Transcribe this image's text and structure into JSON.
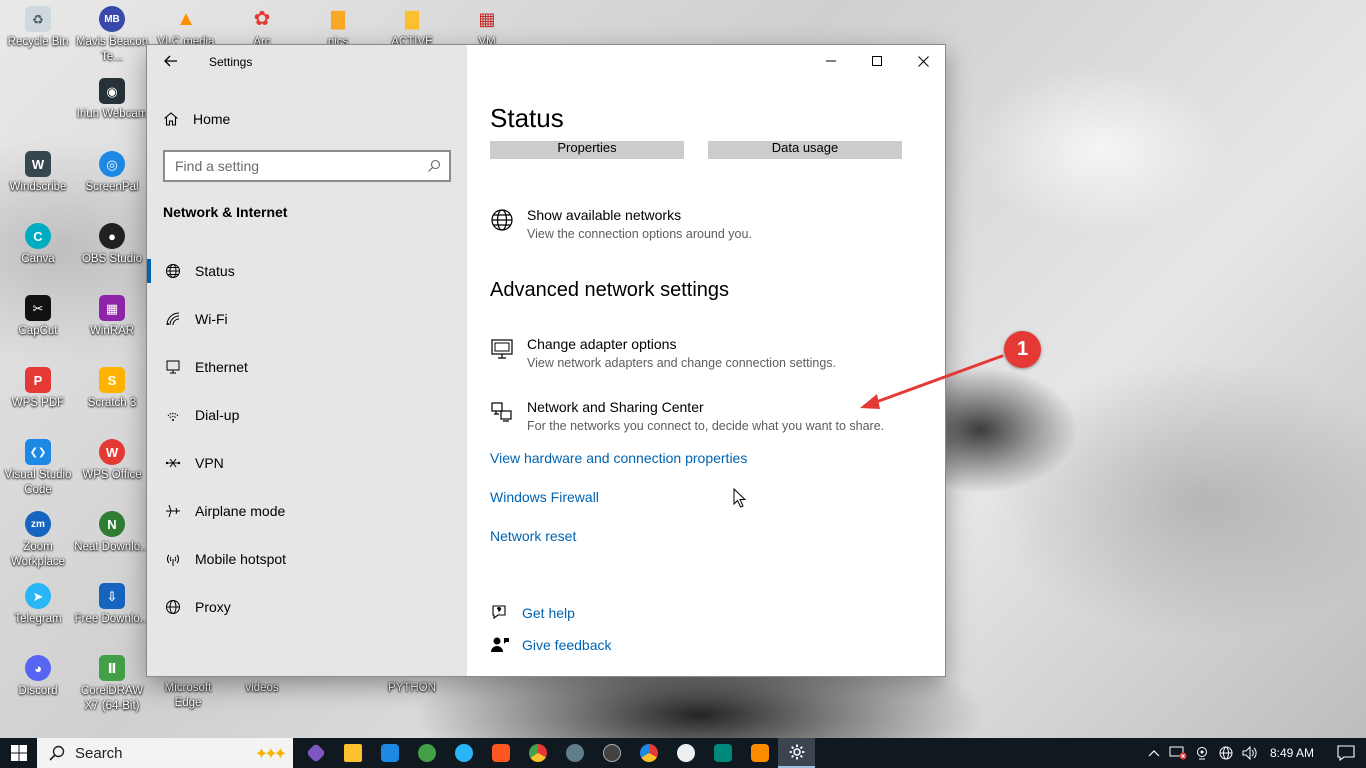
{
  "desktop": {
    "icons": [
      {
        "label": "Recycle Bin",
        "color": "#cfd8dc",
        "glyph": "♻"
      },
      {
        "label": "Mavis Beacon Te...",
        "color": "#3949ab",
        "glyph": "MB"
      },
      {
        "label": "VLC media",
        "color": "#ff8f00",
        "glyph": "▲"
      },
      {
        "label": "Arc",
        "color": "#e53935",
        "glyph": "✿"
      },
      {
        "label": "pics",
        "color": "#f9a825",
        "glyph": "▇"
      },
      {
        "label": "ACTIVE",
        "color": "#fbc02d",
        "glyph": "▇"
      },
      {
        "label": "VM",
        "color": "#c62828",
        "glyph": "▦"
      },
      {
        "label": "Iriun Webcam",
        "color": "#263238",
        "glyph": "◉"
      },
      {
        "label": "Windscribe",
        "color": "#37474f",
        "glyph": "W"
      },
      {
        "label": "ScreenPal",
        "color": "#1e88e5",
        "glyph": "◎"
      },
      {
        "label": "Canva",
        "color": "#00acc1",
        "glyph": "C"
      },
      {
        "label": "OBS Studio",
        "color": "#212121",
        "glyph": "●"
      },
      {
        "label": "CapCut",
        "color": "#111111",
        "glyph": "✂"
      },
      {
        "label": "WinRAR",
        "color": "#8e24aa",
        "glyph": "▦"
      },
      {
        "label": "WPS PDF",
        "color": "#e53935",
        "glyph": "P"
      },
      {
        "label": "Scratch 3",
        "color": "#ffb300",
        "glyph": "S"
      },
      {
        "label": "Visual Studio Code",
        "color": "#1e88e5",
        "glyph": "❮❯"
      },
      {
        "label": "WPS Office",
        "color": "#e53935",
        "glyph": "W"
      },
      {
        "label": "Zoom Workplace",
        "color": "#1565c0",
        "glyph": "zm"
      },
      {
        "label": "Neat Downlo...",
        "color": "#2e7d32",
        "glyph": "N"
      },
      {
        "label": "Telegram",
        "color": "#29b6f6",
        "glyph": "➤"
      },
      {
        "label": "Free Downlo...",
        "color": "#1565c0",
        "glyph": "⇩"
      },
      {
        "label": "Discord",
        "color": "#5865f2",
        "glyph": "◕"
      },
      {
        "label": "CorelDRAW X7 (64-Bit)",
        "color": "#43a047",
        "glyph": "Ⅱ"
      },
      {
        "label": "Microsoft Edge",
        "color": "transparent",
        "glyph": ""
      },
      {
        "label": "videos",
        "color": "transparent",
        "glyph": ""
      },
      {
        "label": "PYTHON",
        "color": "transparent",
        "glyph": ""
      }
    ]
  },
  "window": {
    "title": "Settings",
    "controls": {
      "minimize": "minimize",
      "maximize": "maximize",
      "close": "close"
    }
  },
  "nav": {
    "home_label": "Home",
    "search_placeholder": "Find a setting",
    "section_title": "Network & Internet",
    "items": [
      {
        "label": "Status",
        "icon": "globe-icon",
        "active": true
      },
      {
        "label": "Wi-Fi",
        "icon": "wifi-icon",
        "active": false
      },
      {
        "label": "Ethernet",
        "icon": "ethernet-icon",
        "active": false
      },
      {
        "label": "Dial-up",
        "icon": "dialup-icon",
        "active": false
      },
      {
        "label": "VPN",
        "icon": "vpn-icon",
        "active": false
      },
      {
        "label": "Airplane mode",
        "icon": "airplane-icon",
        "active": false
      },
      {
        "label": "Mobile hotspot",
        "icon": "hotspot-icon",
        "active": false
      },
      {
        "label": "Proxy",
        "icon": "globe-icon",
        "active": false
      }
    ]
  },
  "content": {
    "page_title": "Status",
    "properties_label": "Properties",
    "data_usage_label": "Data usage",
    "show_networks": {
      "title": "Show available networks",
      "desc": "View the connection options around you."
    },
    "advanced_heading": "Advanced network settings",
    "adapter_options": {
      "title": "Change adapter options",
      "desc": "View network adapters and change connection settings."
    },
    "sharing_center": {
      "title": "Network and Sharing Center",
      "desc": "For the networks you connect to, decide what you want to share."
    },
    "links": {
      "hardware": "View hardware and connection properties",
      "firewall": "Windows Firewall",
      "reset": "Network reset"
    },
    "help": {
      "get_help": "Get help",
      "give_feedback": "Give feedback"
    }
  },
  "annotation": {
    "number": "1",
    "color": "#e53935"
  },
  "taskbar": {
    "search_label": "Search",
    "clock": "8:49 AM",
    "apps": [
      {
        "name": "copilot-app",
        "color": "#7e57c2",
        "active": false
      },
      {
        "name": "file-explorer-app",
        "color": "#fbc02d",
        "active": false
      },
      {
        "name": "vscode-app",
        "color": "#1e88e5",
        "active": false
      },
      {
        "name": "whatsapp-app",
        "color": "#43a047",
        "active": false
      },
      {
        "name": "telegram-app",
        "color": "#29b6f6",
        "active": false
      },
      {
        "name": "brave-app",
        "color": "#ff5722",
        "active": false
      },
      {
        "name": "chrome-app",
        "color": "#fbc02d",
        "active": false
      },
      {
        "name": "windscribe-app",
        "color": "#607d8b",
        "active": false
      },
      {
        "name": "obs-app",
        "color": "#424242",
        "active": false
      },
      {
        "name": "chrome-alt-app",
        "color": "#e53935",
        "active": false
      },
      {
        "name": "screenpal-app",
        "color": "#eceff1",
        "active": false
      },
      {
        "name": "vysor-app",
        "color": "#00897b",
        "active": false
      },
      {
        "name": "window-manager-app",
        "color": "#fb8c00",
        "active": false
      },
      {
        "name": "settings-app",
        "color": "#ffffff",
        "active": true
      }
    ]
  }
}
